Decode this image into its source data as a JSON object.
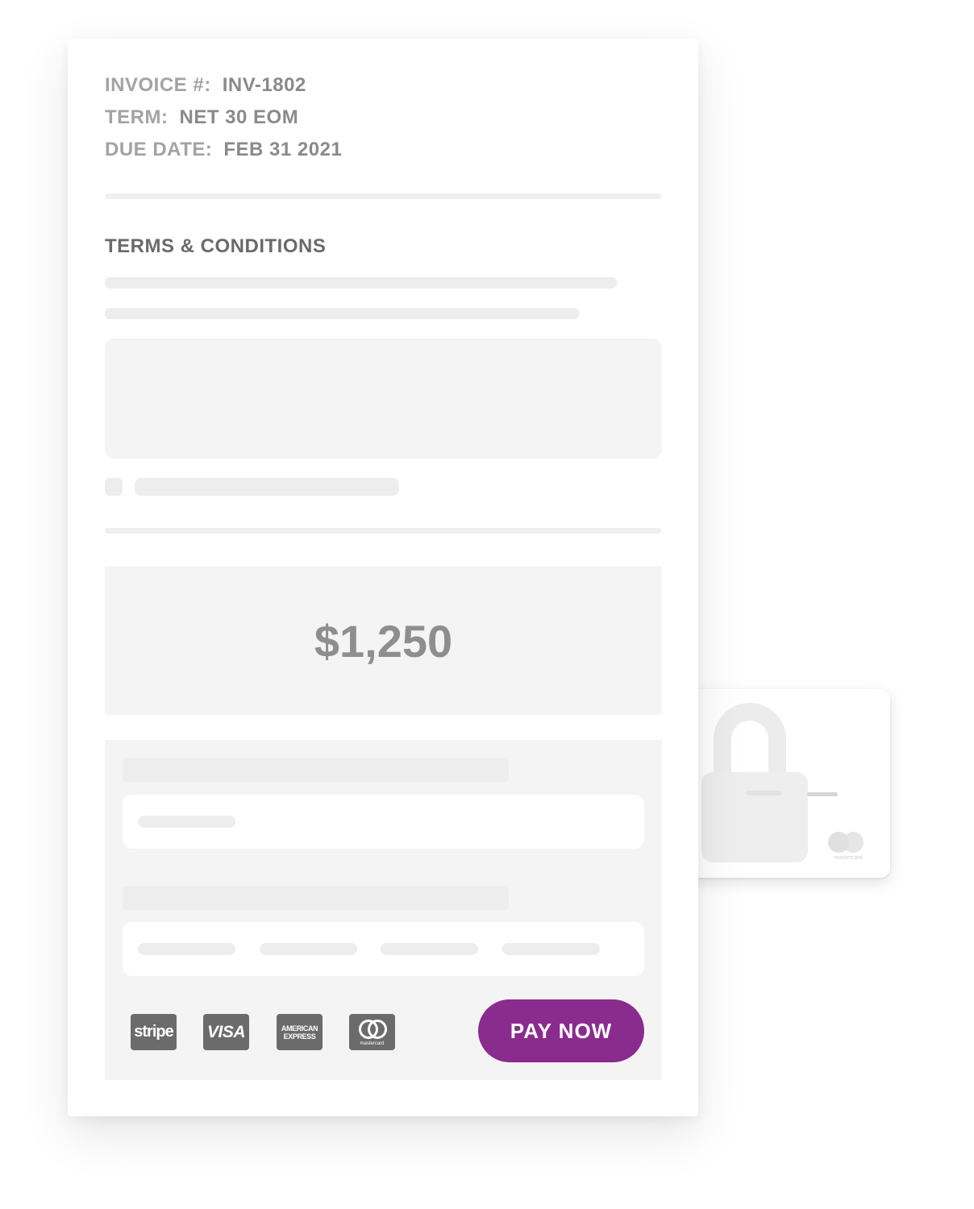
{
  "invoice": {
    "number_label": "INVOICE #:",
    "number_value": "INV-1802",
    "term_label": "TERM:",
    "term_value": "NET 30 EOM",
    "due_label": "DUE DATE:",
    "due_value": "FEB 31 2021"
  },
  "terms": {
    "title": "TERMS & CONDITIONS"
  },
  "payment": {
    "amount": "$1,250",
    "pay_button_label": "PAY NOW",
    "logos": {
      "stripe": "stripe",
      "visa": "VISA",
      "amex_line1": "AMERICAN",
      "amex_line2": "EXPRESS",
      "mastercard": "mastercard"
    },
    "button_color": "#8a2b8e"
  },
  "background_card": {
    "brand_text": "mastercard",
    "icon": "lock-icon"
  }
}
